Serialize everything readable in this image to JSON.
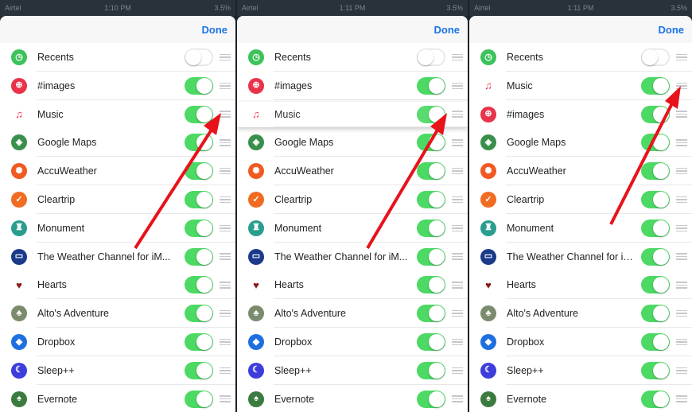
{
  "status": {
    "carrier": "Airtel",
    "time_1": "1:10 PM",
    "time_2": "1:11 PM",
    "time_3": "1:11 PM",
    "battery": "3.5%"
  },
  "done_label": "Done",
  "colors": {
    "toggle_on": "#4cd964",
    "done_blue": "#1a73e8",
    "arrow": "#e8121a"
  },
  "panels": [
    {
      "rows": [
        {
          "label": "Recents",
          "icon": "clock-icon",
          "color": "#3cc35a",
          "glyph": "◷",
          "on": false
        },
        {
          "label": "#images",
          "icon": "images-search-icon",
          "color": "#e8334a",
          "glyph": "⊕",
          "on": true
        },
        {
          "label": "Music",
          "icon": "music-note-icon",
          "color": "#ffffff",
          "glyph": "♫",
          "on": true
        },
        {
          "label": "Google Maps",
          "icon": "google-maps-icon",
          "color": "#3a8f4c",
          "glyph": "◈",
          "on": true
        },
        {
          "label": "AccuWeather",
          "icon": "accuweather-sun-icon",
          "color": "#f05a22",
          "glyph": "✺",
          "on": true
        },
        {
          "label": "Cleartrip",
          "icon": "cleartrip-check-icon",
          "color": "#f26b22",
          "glyph": "✓",
          "on": true
        },
        {
          "label": "Monument",
          "icon": "monument-icon",
          "color": "#2a9d8f",
          "glyph": "♜",
          "on": true
        },
        {
          "label": "The Weather Channel for iM...",
          "icon": "weather-channel-icon",
          "color": "#1b3a8a",
          "glyph": "▭",
          "on": true
        },
        {
          "label": "Hearts",
          "icon": "heart-icon",
          "color": "#ffffff",
          "glyph": "♥",
          "on": true
        },
        {
          "label": "Alto's Adventure",
          "icon": "alto-tree-icon",
          "color": "#7b8c6e",
          "glyph": "♣",
          "on": true
        },
        {
          "label": "Dropbox",
          "icon": "dropbox-icon",
          "color": "#1e6fe0",
          "glyph": "◆",
          "on": true
        },
        {
          "label": "Sleep++",
          "icon": "moon-icon",
          "color": "#3d3ddc",
          "glyph": "☾",
          "on": true
        },
        {
          "label": "Evernote",
          "icon": "evernote-elephant-icon",
          "color": "#3b7b3f",
          "glyph": "♠",
          "on": true
        }
      ]
    },
    {
      "rows": [
        {
          "label": "Recents",
          "icon": "clock-icon",
          "color": "#3cc35a",
          "glyph": "◷",
          "on": false
        },
        {
          "label": "#images",
          "icon": "images-search-icon",
          "color": "#e8334a",
          "glyph": "⊕",
          "on": true
        },
        {
          "label": "Music",
          "icon": "music-note-icon",
          "color": "#ffffff",
          "glyph": "♫",
          "on": true,
          "lifted": true
        },
        {
          "label": "Google Maps",
          "icon": "google-maps-icon",
          "color": "#3a8f4c",
          "glyph": "◈",
          "on": true
        },
        {
          "label": "AccuWeather",
          "icon": "accuweather-sun-icon",
          "color": "#f05a22",
          "glyph": "✺",
          "on": true
        },
        {
          "label": "Cleartrip",
          "icon": "cleartrip-check-icon",
          "color": "#f26b22",
          "glyph": "✓",
          "on": true
        },
        {
          "label": "Monument",
          "icon": "monument-icon",
          "color": "#2a9d8f",
          "glyph": "♜",
          "on": true
        },
        {
          "label": "The Weather Channel for iM...",
          "icon": "weather-channel-icon",
          "color": "#1b3a8a",
          "glyph": "▭",
          "on": true
        },
        {
          "label": "Hearts",
          "icon": "heart-icon",
          "color": "#ffffff",
          "glyph": "♥",
          "on": true
        },
        {
          "label": "Alto's Adventure",
          "icon": "alto-tree-icon",
          "color": "#7b8c6e",
          "glyph": "♣",
          "on": true
        },
        {
          "label": "Dropbox",
          "icon": "dropbox-icon",
          "color": "#1e6fe0",
          "glyph": "◆",
          "on": true
        },
        {
          "label": "Sleep++",
          "icon": "moon-icon",
          "color": "#3d3ddc",
          "glyph": "☾",
          "on": true
        },
        {
          "label": "Evernote",
          "icon": "evernote-elephant-icon",
          "color": "#3b7b3f",
          "glyph": "♠",
          "on": true
        }
      ]
    },
    {
      "rows": [
        {
          "label": "Recents",
          "icon": "clock-icon",
          "color": "#3cc35a",
          "glyph": "◷",
          "on": false
        },
        {
          "label": "Music",
          "icon": "music-note-icon",
          "color": "#ffffff",
          "glyph": "♫",
          "on": true
        },
        {
          "label": "#images",
          "icon": "images-search-icon",
          "color": "#e8334a",
          "glyph": "⊕",
          "on": true
        },
        {
          "label": "Google Maps",
          "icon": "google-maps-icon",
          "color": "#3a8f4c",
          "glyph": "◈",
          "on": true
        },
        {
          "label": "AccuWeather",
          "icon": "accuweather-sun-icon",
          "color": "#f05a22",
          "glyph": "✺",
          "on": true
        },
        {
          "label": "Cleartrip",
          "icon": "cleartrip-check-icon",
          "color": "#f26b22",
          "glyph": "✓",
          "on": true
        },
        {
          "label": "Monument",
          "icon": "monument-icon",
          "color": "#2a9d8f",
          "glyph": "♜",
          "on": true
        },
        {
          "label": "The Weather Channel for iM...",
          "icon": "weather-channel-icon",
          "color": "#1b3a8a",
          "glyph": "▭",
          "on": true
        },
        {
          "label": "Hearts",
          "icon": "heart-icon",
          "color": "#ffffff",
          "glyph": "♥",
          "on": true
        },
        {
          "label": "Alto's Adventure",
          "icon": "alto-tree-icon",
          "color": "#7b8c6e",
          "glyph": "♣",
          "on": true
        },
        {
          "label": "Dropbox",
          "icon": "dropbox-icon",
          "color": "#1e6fe0",
          "glyph": "◆",
          "on": true
        },
        {
          "label": "Sleep++",
          "icon": "moon-icon",
          "color": "#3d3ddc",
          "glyph": "☾",
          "on": true
        },
        {
          "label": "Evernote",
          "icon": "evernote-elephant-icon",
          "color": "#3b7b3f",
          "glyph": "♠",
          "on": true
        }
      ]
    }
  ]
}
